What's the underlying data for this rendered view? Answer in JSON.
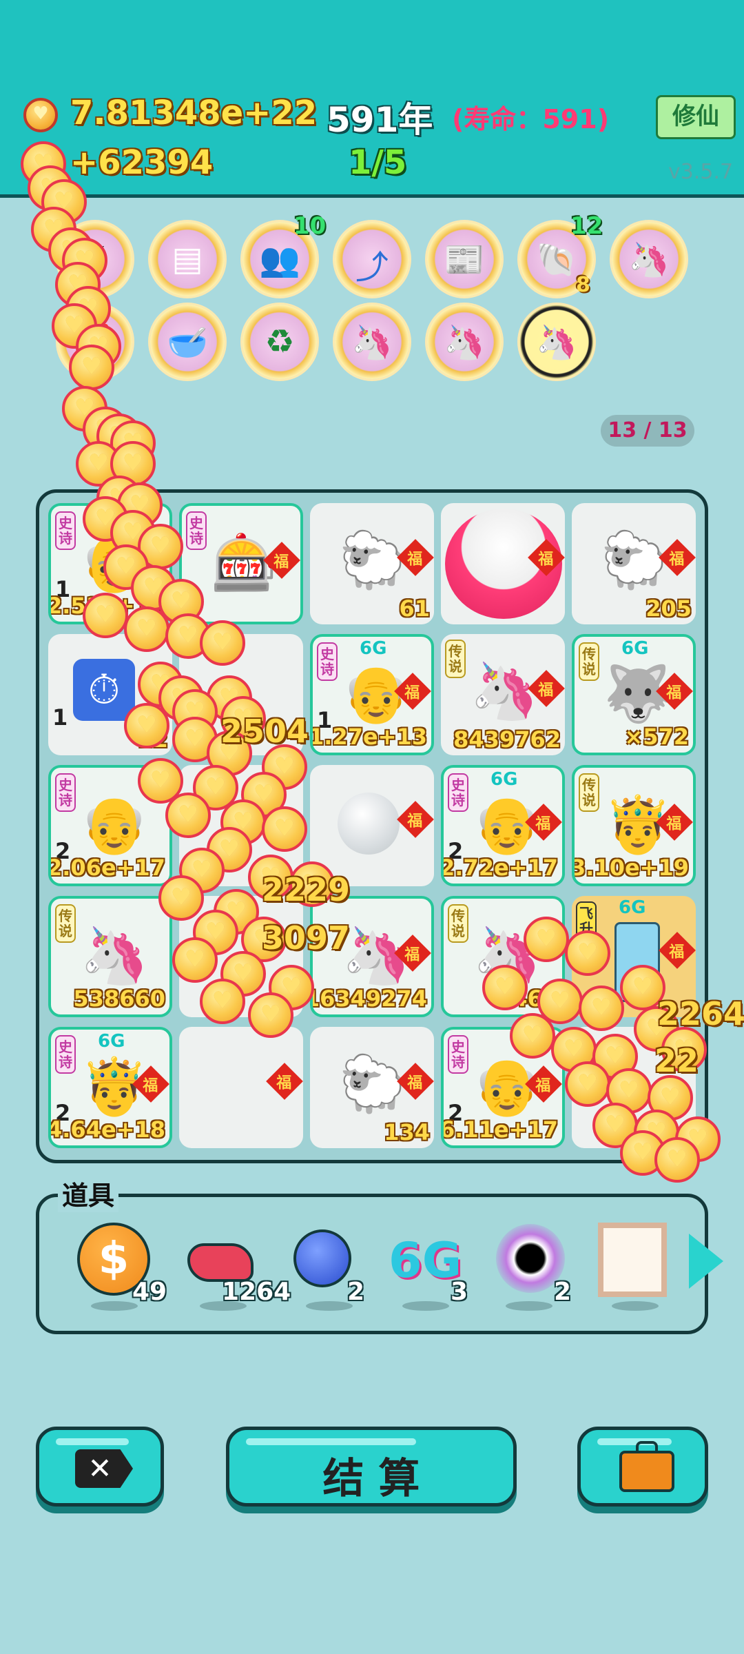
{
  "header": {
    "coins_total": "7.81348e+22",
    "coins_per_tick": "+62394",
    "age": "591年",
    "lifespan_label": "(寿命：591)",
    "stage": "1/5",
    "xiuxian_label": "修仙",
    "version": "v3.5.7"
  },
  "buffs": {
    "count_people": "10",
    "count_shell": "12",
    "count_shell_sub": "8"
  },
  "board": {
    "progress": "13 / 13",
    "tags": {
      "epic": "史诗",
      "legend": "传说",
      "fly": "飞升",
      "fu": "福",
      "gg": "6G"
    },
    "cells": [
      {
        "value": "2.51e+17",
        "level": "1"
      },
      {
        "value": ""
      },
      {
        "value": "61"
      },
      {
        "value": ""
      },
      {
        "value": "205"
      },
      {
        "value": "12",
        "level": "1"
      },
      {
        "value": ""
      },
      {
        "value": "1.27e+13",
        "level": "1"
      },
      {
        "value": "8439762"
      },
      {
        "value": "×572"
      },
      {
        "value": "2.06e+17",
        "level": "2"
      },
      {
        "value": ""
      },
      {
        "value": ""
      },
      {
        "value": "2.72e+17",
        "level": "2"
      },
      {
        "value": "3.10e+19"
      },
      {
        "value": "538660"
      },
      {
        "value": ""
      },
      {
        "value": "16349274"
      },
      {
        "value": "468"
      },
      {
        "value": ""
      },
      {
        "value": "4.64e+18",
        "level": "2"
      },
      {
        "value": ""
      },
      {
        "value": "134"
      },
      {
        "value": "6.11e+17",
        "level": "2"
      },
      {
        "value": ""
      }
    ],
    "floating_numbers": [
      "2504",
      "2229",
      "3097",
      "2264",
      "22"
    ]
  },
  "items": {
    "title": "道具",
    "list": [
      {
        "icon": "dollar-coin-icon",
        "count": "49"
      },
      {
        "icon": "liver-icon",
        "count": "1264"
      },
      {
        "icon": "blueberry-icon",
        "count": "2"
      },
      {
        "icon": "6g-icon",
        "label": "6G",
        "count": "3"
      },
      {
        "icon": "black-hole-icon",
        "count": "2"
      },
      {
        "icon": "frame-icon",
        "count": ""
      }
    ]
  },
  "bottom": {
    "settle_label": "结 算"
  },
  "colors": {
    "header_bg": "#1fc2bf",
    "page_bg": "#a9dade",
    "accent_teal": "#2ad2cd",
    "coin_gold": "#ffd84a"
  }
}
